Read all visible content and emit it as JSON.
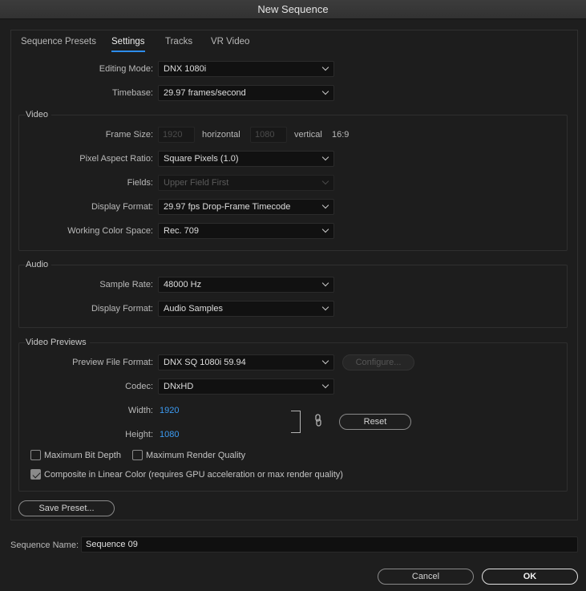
{
  "window": {
    "title": "New Sequence"
  },
  "tabs": [
    {
      "label": "Sequence Presets"
    },
    {
      "label": "Settings"
    },
    {
      "label": "Tracks"
    },
    {
      "label": "VR Video"
    }
  ],
  "editing_mode": {
    "label": "Editing Mode:",
    "value": "DNX 1080i"
  },
  "timebase": {
    "label": "Timebase:",
    "value": "29.97  frames/second"
  },
  "video": {
    "title": "Video",
    "frame_size": {
      "label": "Frame Size:",
      "width": "1920",
      "horizontal": "horizontal",
      "height": "1080",
      "vertical": "vertical",
      "ratio": "16:9"
    },
    "pixel_aspect": {
      "label": "Pixel Aspect Ratio:",
      "value": "Square Pixels (1.0)"
    },
    "fields": {
      "label": "Fields:",
      "value": "Upper Field First"
    },
    "display_format": {
      "label": "Display Format:",
      "value": "29.97 fps Drop-Frame Timecode"
    },
    "color_space": {
      "label": "Working Color Space:",
      "value": "Rec. 709"
    }
  },
  "audio": {
    "title": "Audio",
    "sample_rate": {
      "label": "Sample Rate:",
      "value": "48000 Hz"
    },
    "display_format": {
      "label": "Display Format:",
      "value": "Audio Samples"
    }
  },
  "previews": {
    "title": "Video Previews",
    "file_format": {
      "label": "Preview File Format:",
      "value": "DNX SQ 1080i 59.94"
    },
    "configure_label": "Configure...",
    "codec": {
      "label": "Codec:",
      "value": "DNxHD"
    },
    "width": {
      "label": "Width:",
      "value": "1920"
    },
    "height": {
      "label": "Height:",
      "value": "1080"
    },
    "reset_label": "Reset",
    "max_bit_depth": {
      "label": "Maximum Bit Depth",
      "checked": false
    },
    "max_render_quality": {
      "label": "Maximum Render Quality",
      "checked": false
    },
    "linear_color": {
      "label": "Composite in Linear Color (requires GPU acceleration or max render quality)",
      "checked": true
    }
  },
  "save_preset_label": "Save Preset...",
  "sequence_name": {
    "label": "Sequence Name:",
    "value": "Sequence 09"
  },
  "cancel_label": "Cancel",
  "ok_label": "OK",
  "colors": {
    "accent": "#2d8ceb",
    "link_value": "#3c9bf2",
    "background": "#1e1e1e"
  }
}
